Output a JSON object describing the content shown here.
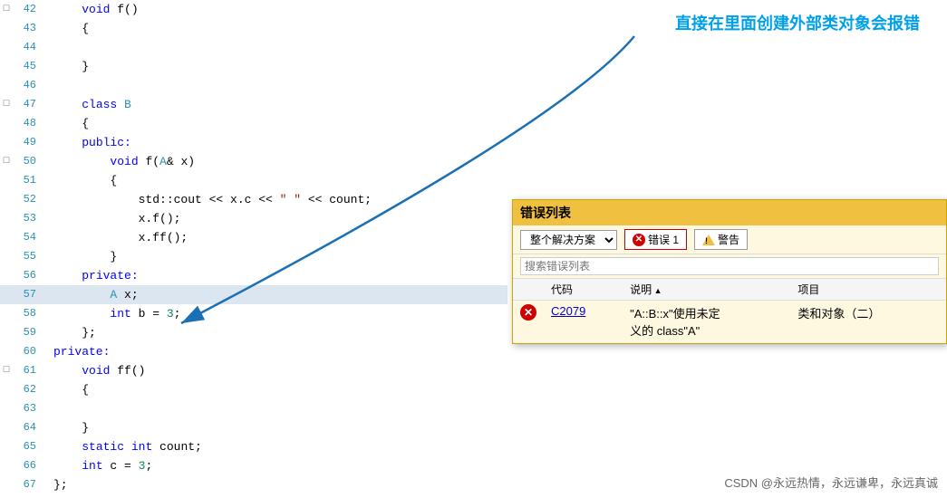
{
  "annotation": {
    "text": "直接在里面创建外部类对象会报错"
  },
  "errorPanel": {
    "title": "错误列表",
    "scopeLabel": "整个解决方案",
    "errorBadge": "错误 1",
    "warningLabel": "警告",
    "searchPlaceholder": "搜索错误列表",
    "columns": [
      "",
      "代码",
      "说明",
      "项目"
    ],
    "rows": [
      {
        "icon": "error",
        "code": "C2079",
        "description": "\"A::B::x\"使用未定\n义的 class\"A\"",
        "project": "类和对象（二）"
      }
    ]
  },
  "codeLines": [
    {
      "num": 42,
      "expand": "□",
      "content": "void f()",
      "indent": 1,
      "highlighted": false
    },
    {
      "num": 43,
      "expand": "",
      "content": "{",
      "indent": 1,
      "highlighted": false
    },
    {
      "num": 44,
      "expand": "",
      "content": "",
      "indent": 0,
      "highlighted": false
    },
    {
      "num": 45,
      "expand": "",
      "content": "}",
      "indent": 1,
      "highlighted": false
    },
    {
      "num": 46,
      "expand": "",
      "content": "",
      "indent": 0,
      "highlighted": false
    },
    {
      "num": 47,
      "expand": "□",
      "content": "class B",
      "indent": 1,
      "highlighted": false
    },
    {
      "num": 48,
      "expand": "",
      "content": "{",
      "indent": 1,
      "highlighted": false
    },
    {
      "num": 49,
      "expand": "",
      "content": "public:",
      "indent": 1,
      "highlighted": false
    },
    {
      "num": 50,
      "expand": "□",
      "content": "    void f(A& x)",
      "indent": 2,
      "highlighted": false
    },
    {
      "num": 51,
      "expand": "",
      "content": "    {",
      "indent": 2,
      "highlighted": false
    },
    {
      "num": 52,
      "expand": "",
      "content": "        std::cout << x.c << \" \" << count;",
      "indent": 3,
      "highlighted": false
    },
    {
      "num": 53,
      "expand": "",
      "content": "        x.f();",
      "indent": 3,
      "highlighted": false
    },
    {
      "num": 54,
      "expand": "",
      "content": "        x.ff();",
      "indent": 3,
      "highlighted": false
    },
    {
      "num": 55,
      "expand": "",
      "content": "    }",
      "indent": 2,
      "highlighted": false
    },
    {
      "num": 56,
      "expand": "",
      "content": "private:",
      "indent": 1,
      "highlighted": false
    },
    {
      "num": 57,
      "expand": "",
      "content": "    A x;",
      "indent": 2,
      "highlighted": true
    },
    {
      "num": 58,
      "expand": "",
      "content": "    int b = 3;",
      "indent": 2,
      "highlighted": false
    },
    {
      "num": 59,
      "expand": "",
      "content": "};",
      "indent": 1,
      "highlighted": false
    },
    {
      "num": 60,
      "expand": "",
      "content": "private:",
      "indent": 1,
      "highlighted": false
    },
    {
      "num": 61,
      "expand": "□",
      "content": "    void ff()",
      "indent": 2,
      "highlighted": false
    },
    {
      "num": 62,
      "expand": "",
      "content": "    {",
      "indent": 2,
      "highlighted": false
    },
    {
      "num": 63,
      "expand": "",
      "content": "",
      "indent": 0,
      "highlighted": false
    },
    {
      "num": 64,
      "expand": "",
      "content": "    }",
      "indent": 2,
      "highlighted": false
    },
    {
      "num": 65,
      "expand": "",
      "content": "    static int count;",
      "indent": 2,
      "highlighted": false
    },
    {
      "num": 66,
      "expand": "",
      "content": "    int c = 3;",
      "indent": 2,
      "highlighted": false
    },
    {
      "num": 67,
      "expand": "",
      "content": "};",
      "indent": 1,
      "highlighted": false
    }
  ],
  "csdn": {
    "watermark": "CSDN @永远热情，永远谦卑，永远真诚"
  }
}
